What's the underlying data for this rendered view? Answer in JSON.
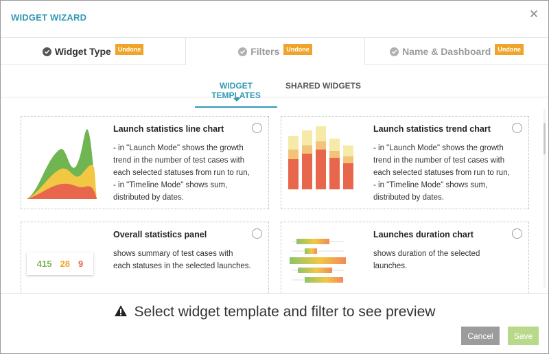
{
  "modal": {
    "title": "WIDGET WIZARD"
  },
  "steps": [
    {
      "label": "Widget Type",
      "badge": "Undone",
      "state": "current"
    },
    {
      "label": "Filters",
      "badge": "Undone",
      "state": "pending"
    },
    {
      "label": "Name & Dashboard",
      "badge": "Undone",
      "state": "pending"
    }
  ],
  "tabs": [
    {
      "label": "WIDGET TEMPLATES",
      "active": true
    },
    {
      "label": "SHARED WIDGETS",
      "active": false
    }
  ],
  "templates": [
    {
      "title": "Launch statistics line chart",
      "lines": [
        "- in \"Launch Mode\" shows the growth",
        "trend in the number of test cases with",
        "each selected statuses from run to run,",
        "- in \"Timeline Mode\" shows sum,",
        "distributed by dates."
      ],
      "thumbnail": "area-chart-thumbnail",
      "selected": false
    },
    {
      "title": "Launch statistics trend chart",
      "lines": [
        "- in \"Launch Mode\" shows the growth",
        "trend in the number of test cases with",
        "each selected statuses from run to run,",
        "- in \"Timeline Mode\" shows sum,",
        "distributed by dates."
      ],
      "thumbnail": "stacked-bar-thumbnail",
      "selected": false
    },
    {
      "title": "Overall statistics panel",
      "lines": [
        "shows summary of test cases with",
        "each statuses in the selected launches."
      ],
      "thumbnail": "stats-panel-thumbnail",
      "stats": [
        "415",
        "28",
        "9"
      ],
      "selected": false
    },
    {
      "title": "Launches duration chart",
      "lines": [
        "shows duration of the selected",
        "launches."
      ],
      "thumbnail": "duration-chart-thumbnail",
      "selected": false
    }
  ],
  "preview_message": "Select widget template and filter to see preview",
  "buttons": {
    "cancel": "Cancel",
    "save": "Save"
  },
  "colors": {
    "accent": "#2f9ab5",
    "badge": "#f0a52a",
    "passed": "#7cb35c",
    "skipped": "#f0a52a",
    "failed": "#e8674c",
    "cancel_button": "#9c9c9c",
    "save_button_disabled": "#b8d98a"
  }
}
